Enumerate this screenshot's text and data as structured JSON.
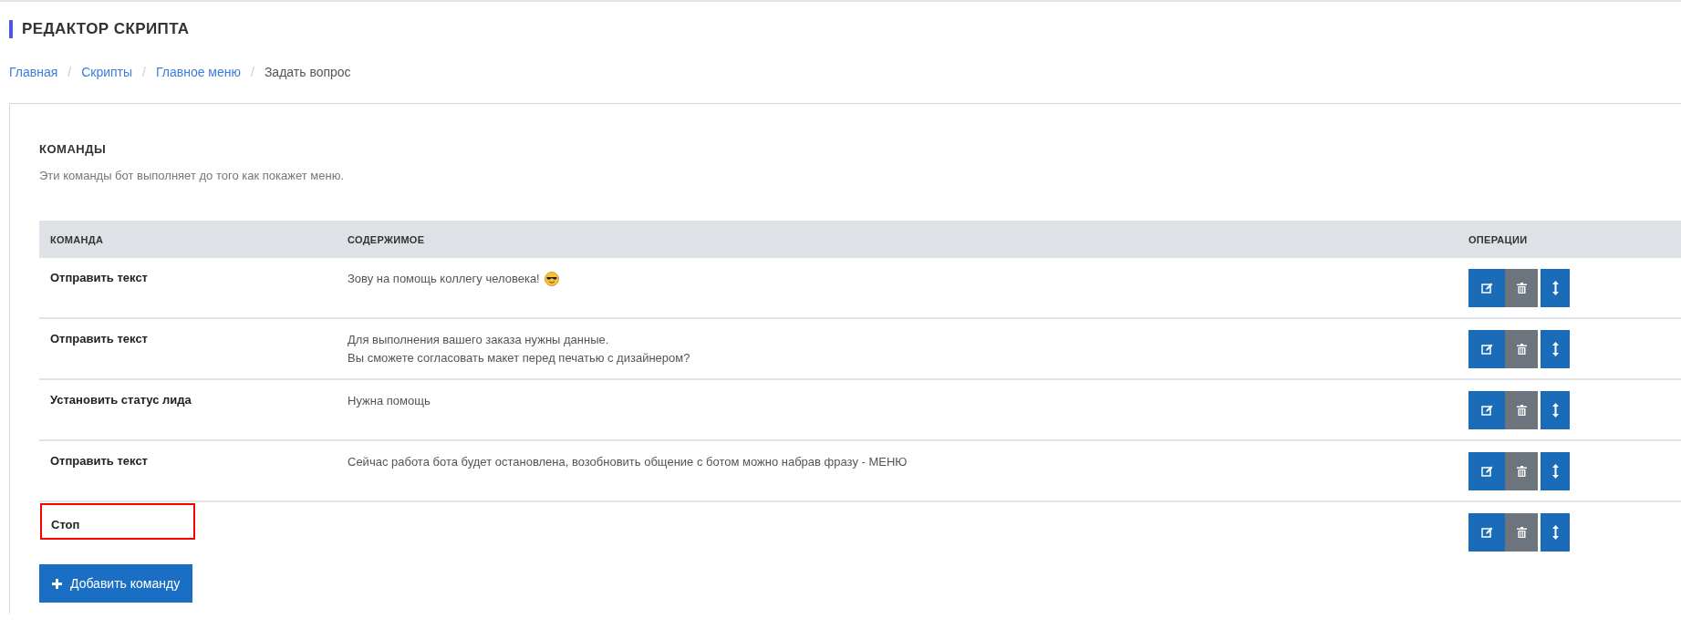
{
  "page_title": "РЕДАКТОР СКРИПТА",
  "breadcrumb_separator": "/",
  "breadcrumbs": [
    {
      "label": "Главная",
      "kind": "link"
    },
    {
      "label": "Скрипты",
      "kind": "link"
    },
    {
      "label": "Главное меню",
      "kind": "link"
    },
    {
      "label": "Задать вопрос",
      "kind": "current"
    }
  ],
  "section": {
    "title": "КОМАНДЫ",
    "subtitle": "Эти команды бот выполняет до того как покажет меню."
  },
  "table": {
    "columns": [
      "КОМАНДА",
      "СОДЕРЖИМОЕ",
      "ОПЕРАЦИИ"
    ],
    "rows": [
      {
        "command": "Отправить текст",
        "content": [
          "Зову на помощь коллегу человека!"
        ],
        "emoji_after": true,
        "highlighted": false
      },
      {
        "command": "Отправить текст",
        "content": [
          "Для выполнения вашего заказа нужны данные.",
          "Вы сможете согласовать макет перед печатью с дизайнером?"
        ],
        "highlighted": false
      },
      {
        "command": "Установить статус лида",
        "content": [
          "Нужна помощь"
        ],
        "highlighted": false
      },
      {
        "command": "Отправить текст",
        "content": [
          "Сейчас работа бота будет остановлена, возобновить общение с ботом можно набрав фразу - МЕНЮ"
        ],
        "highlighted": false
      },
      {
        "command": "Стоп",
        "content": [],
        "highlighted": true
      }
    ]
  },
  "add_button": {
    "label": "Добавить команду"
  }
}
